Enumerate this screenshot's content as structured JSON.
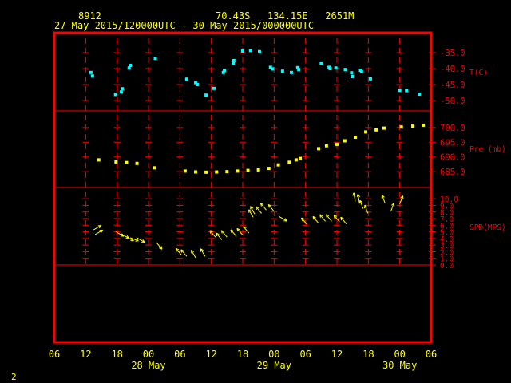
{
  "header": {
    "station": "8912",
    "location": "70.43S   134.15E   2651M",
    "period": "27 May 2015/120000UTC - 30 May 2015/000000UTC"
  },
  "page_number": "2",
  "colors": {
    "background": "#000000",
    "frame": "#ff0000",
    "text": "#ffff00",
    "temperature": "#00ffff",
    "pressure": "#ffff00",
    "wind": "#ffff00",
    "grid": "#ff0000"
  },
  "chart_data": {
    "type": "scatter",
    "x_unit": "hours from 27 May 2015 06 UTC",
    "x_tick_labels": [
      "06",
      "12",
      "18",
      "00",
      "06",
      "12",
      "18",
      "00",
      "06",
      "12",
      "18",
      "00",
      "06"
    ],
    "x_date_labels": [
      {
        "hour": 18,
        "label": "28 May"
      },
      {
        "hour": 42,
        "label": "29 May"
      },
      {
        "hour": 66,
        "label": "30 May"
      }
    ],
    "xlim": [
      0,
      72
    ],
    "panels": [
      {
        "name": "temperature",
        "label": "T(C)",
        "ylim": [
          -52,
          -32.5
        ],
        "ticks": [
          -35.0,
          -40.0,
          -45.0,
          -50.0
        ],
        "tick_labels": [
          "-35.0",
          "-40.0",
          "-45.0",
          "-50.0"
        ],
        "points": [
          [
            7,
            -41.2
          ],
          [
            7.3,
            -42.3
          ],
          [
            11.7,
            -48.1
          ],
          [
            12.8,
            -47.3
          ],
          [
            13,
            -46.3
          ],
          [
            14.3,
            -39.8
          ],
          [
            14.5,
            -39
          ],
          [
            19.3,
            -36.8
          ],
          [
            25.3,
            -43.3
          ],
          [
            27,
            -44.4
          ],
          [
            27.3,
            -45
          ],
          [
            29,
            -48.3
          ],
          [
            30.5,
            -46.2
          ],
          [
            32.3,
            -41.2
          ],
          [
            32.5,
            -40.6
          ],
          [
            34.2,
            -38.3
          ],
          [
            34.3,
            -37.5
          ],
          [
            36,
            -34.5
          ],
          [
            37.5,
            -34.3
          ],
          [
            39.2,
            -34.7
          ],
          [
            41.3,
            -39.6
          ],
          [
            41.7,
            -40.1
          ],
          [
            43.6,
            -40.8
          ],
          [
            45.3,
            -41.2
          ],
          [
            46.5,
            -39.7
          ],
          [
            46.7,
            -40.3
          ],
          [
            51,
            -38.5
          ],
          [
            52.5,
            -39.6
          ],
          [
            52.7,
            -40
          ],
          [
            53.8,
            -39.8
          ],
          [
            55.6,
            -40.3
          ],
          [
            56.8,
            -41.3
          ],
          [
            56.9,
            -42.5
          ],
          [
            58.5,
            -40.5
          ],
          [
            58.7,
            -41
          ],
          [
            60.4,
            -43.2
          ],
          [
            66,
            -46.8
          ],
          [
            67.3,
            -46.9
          ],
          [
            69.7,
            -48
          ]
        ]
      },
      {
        "name": "pressure",
        "label": "Pre (mb)",
        "ylim": [
          681.5,
          703.5
        ],
        "ticks": [
          700.0,
          695.0,
          690.0,
          685.0
        ],
        "tick_labels": [
          "700.0",
          "695.0",
          "690.0",
          "685.0"
        ],
        "points": [
          [
            8.5,
            689
          ],
          [
            11.8,
            688.3
          ],
          [
            13.8,
            688.1
          ],
          [
            15.8,
            687.8
          ],
          [
            19.2,
            686.3
          ],
          [
            25,
            685.2
          ],
          [
            27,
            684.9
          ],
          [
            29,
            684.8
          ],
          [
            31,
            684.9
          ],
          [
            33,
            685
          ],
          [
            35,
            685.2
          ],
          [
            37,
            685.4
          ],
          [
            39,
            685.6
          ],
          [
            41,
            686.1
          ],
          [
            42.8,
            687.3
          ],
          [
            44.9,
            688.2
          ],
          [
            46.2,
            689
          ],
          [
            47,
            689.5
          ],
          [
            50.5,
            692.8
          ],
          [
            52,
            693.8
          ],
          [
            54,
            694.3
          ],
          [
            55.5,
            695.5
          ],
          [
            57.5,
            696.7
          ],
          [
            59.5,
            698.5
          ],
          [
            61.5,
            699.2
          ],
          [
            63,
            699.8
          ],
          [
            66.3,
            700.2
          ],
          [
            68.5,
            700.5
          ],
          [
            70.5,
            700.8
          ]
        ]
      },
      {
        "name": "wind",
        "label": "SPD(MPS)",
        "ylim": [
          0,
          10.5
        ],
        "ticks": [
          0,
          1,
          2,
          3,
          4,
          5,
          6,
          7,
          8,
          9,
          10
        ],
        "tick_labels": [
          "0.0",
          "1.0",
          "2.0",
          "3.0",
          "4.0",
          "5.0",
          "6.0",
          "7.0",
          "8.0",
          "9.0",
          "10.0"
        ],
        "points": [
          [
            7.5,
            5.3,
            60
          ],
          [
            7.8,
            4.6,
            60
          ],
          [
            11.8,
            5,
            120
          ],
          [
            12.8,
            4.7,
            120
          ],
          [
            13.7,
            4.3,
            120
          ],
          [
            14.5,
            4.1,
            110
          ],
          [
            15.8,
            4.1,
            120
          ],
          [
            19.5,
            3.4,
            140
          ],
          [
            24.3,
            1.5,
            320
          ],
          [
            25.3,
            1.3,
            320
          ],
          [
            27,
            1.1,
            330
          ],
          [
            28.8,
            1.3,
            330
          ],
          [
            30.8,
            4.2,
            320
          ],
          [
            32,
            3.8,
            320
          ],
          [
            33,
            4.2,
            320
          ],
          [
            34.8,
            4.3,
            320
          ],
          [
            36,
            4.5,
            320
          ],
          [
            37.2,
            4.8,
            320
          ],
          [
            38,
            7.2,
            330
          ],
          [
            38.3,
            7.7,
            330
          ],
          [
            39.6,
            7.8,
            320
          ],
          [
            40.5,
            8.3,
            320
          ],
          [
            42,
            8.1,
            320
          ],
          [
            43,
            7.3,
            120
          ],
          [
            48.3,
            6.1,
            320
          ],
          [
            50.5,
            6.3,
            320
          ],
          [
            51.8,
            6.6,
            320
          ],
          [
            53,
            6.6,
            320
          ],
          [
            54.5,
            6.5,
            320
          ],
          [
            55.8,
            6.2,
            320
          ],
          [
            57.5,
            9.6,
            350
          ],
          [
            58.3,
            9.4,
            350
          ],
          [
            59,
            8.5,
            340
          ],
          [
            59.9,
            7.8,
            340
          ],
          [
            63.2,
            9.3,
            340
          ],
          [
            64.3,
            8.1,
            20
          ],
          [
            66,
            9.2,
            20
          ]
        ]
      }
    ]
  }
}
